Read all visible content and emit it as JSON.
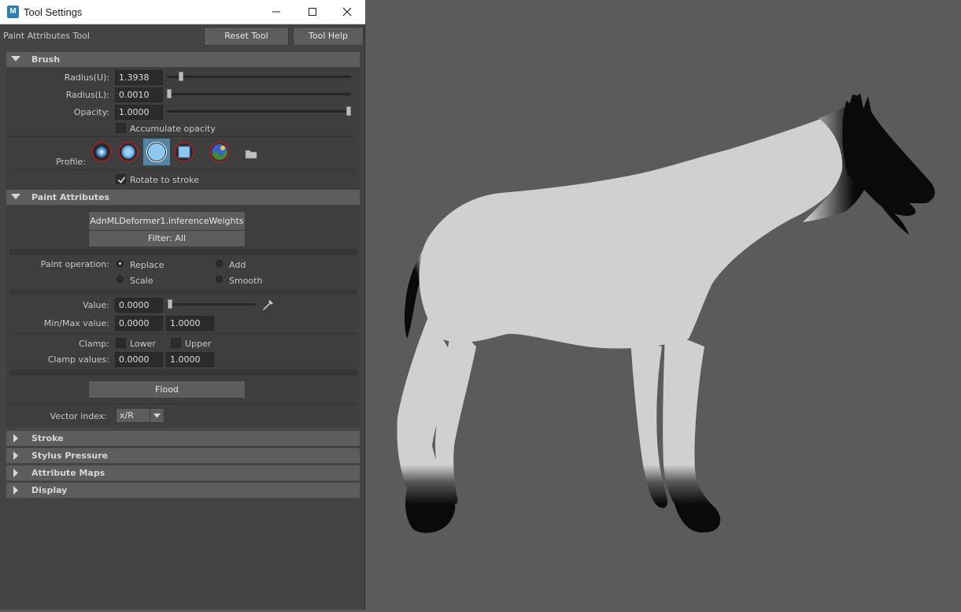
{
  "window": {
    "title": "Tool Settings",
    "icon_letter": "M",
    "controls": [
      "minimize-icon",
      "maximize-icon",
      "close-icon"
    ]
  },
  "header": {
    "tool_name": "Paint Attributes Tool",
    "reset_label": "Reset Tool",
    "help_label": "Tool Help"
  },
  "brush": {
    "title": "Brush",
    "radius_u": {
      "label": "Radius(U):",
      "value": "1.3938",
      "fraction": 0.04
    },
    "radius_l": {
      "label": "Radius(L):",
      "value": "0.0010",
      "fraction": 0.0
    },
    "opacity": {
      "label": "Opacity:",
      "value": "1.0000",
      "fraction": 1.0
    },
    "accumulate_label": "Accumulate opacity",
    "accumulate_checked": false,
    "profile_label": "Profile:",
    "profile_icons": [
      "gaussian-brush-icon",
      "soft-brush-icon",
      "solid-brush-icon",
      "square-brush-icon",
      "image-brush-icon",
      "folder-icon"
    ],
    "profile_selected": "solid-brush-icon",
    "rotate_label": "Rotate to stroke",
    "rotate_checked": true
  },
  "paint_attributes": {
    "title": "Paint Attributes",
    "attribute_button": "AdnMLDeformer1.inferenceWeights",
    "filter_button": "Filter: All",
    "operation_label": "Paint operation:",
    "operations": [
      "Replace",
      "Add",
      "Scale",
      "Smooth"
    ],
    "operation_selected": "Replace",
    "value": {
      "label": "Value:",
      "value": "0.0000",
      "fraction": 0.0
    },
    "minmax": {
      "label": "Min/Max value:",
      "min": "0.0000",
      "max": "1.0000"
    },
    "clamp": {
      "label": "Clamp:",
      "lower": "Lower",
      "upper": "Upper",
      "lower_checked": false,
      "upper_checked": false
    },
    "clamp_values": {
      "label": "Clamp values:",
      "min": "0.0000",
      "max": "1.0000"
    },
    "flood_label": "Flood",
    "vector_index": {
      "label": "Vector index:",
      "value": "x/R"
    }
  },
  "collapsed_sections": [
    "Stroke",
    "Stylus Pressure",
    "Attribute Maps",
    "Display"
  ],
  "colors": {
    "panel_bg": "#444444",
    "header_bg": "#5d5d5d",
    "selected": "#5285a6",
    "viewport_bg": "#5b5b5b",
    "weight_white": "#d0d0d0",
    "weight_black": "#0a0a0a"
  }
}
